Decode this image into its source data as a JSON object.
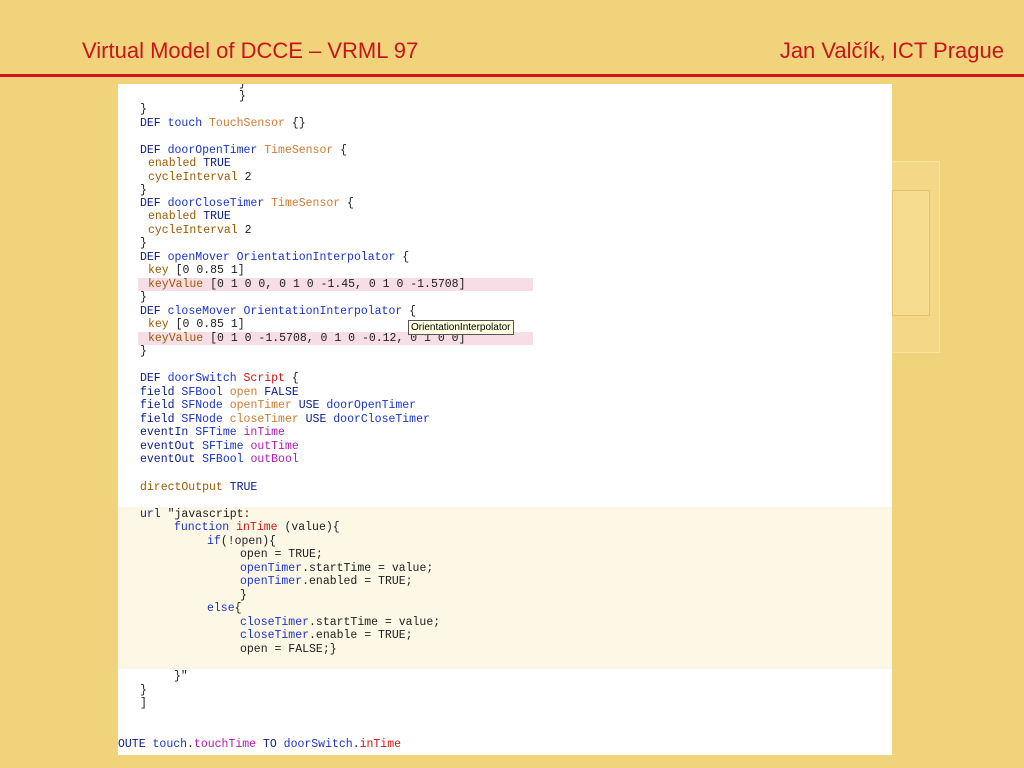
{
  "header": {
    "title": "Virtual Model of DCCE – VRML 97",
    "author": "Jan Valčík, ICT Prague"
  },
  "tooltip": "OrientationInterpolator",
  "code": {
    "l0": "}",
    "l1": "}",
    "l2": [
      "DEF ",
      "touch ",
      "TouchSensor",
      " {}"
    ],
    "l3": [
      "DEF ",
      "doorOpenTimer ",
      "TimeSensor",
      " {"
    ],
    "l4": [
      "enabled ",
      "TRUE"
    ],
    "l5": [
      "cycleInterval ",
      "2"
    ],
    "l6": "}",
    "l7": [
      "DEF ",
      "doorCloseTimer ",
      "TimeSensor",
      " {"
    ],
    "l8": [
      "enabled ",
      "TRUE"
    ],
    "l9": [
      "cycleInterval ",
      "2"
    ],
    "l10": "}",
    "l11": [
      "DEF ",
      "openMover ",
      "OrientationInterpolator",
      " {"
    ],
    "l12": [
      "key ",
      "[0 0.85 1]"
    ],
    "l13": [
      "keyValue ",
      "[0 1 0 0, 0 1 0 -1.45, 0 1 0 -1.5708]"
    ],
    "l14": "}",
    "l15": [
      "DEF ",
      "closeMover ",
      "OrientationInterpolator",
      " {"
    ],
    "l16": [
      "key ",
      "[0 0.85 1]"
    ],
    "l17": [
      "keyValue ",
      "[0 1 0 -1.5708, 0 1 0 -0.12, 0 1 0 0]"
    ],
    "l18": "}",
    "l19": [
      "DEF ",
      "doorSwitch ",
      "Script",
      " {"
    ],
    "l20": [
      "field ",
      "SFBool ",
      "open ",
      "FALSE"
    ],
    "l21": [
      "field ",
      "SFNode ",
      "openTimer ",
      "USE ",
      "doorOpenTimer"
    ],
    "l22": [
      "field ",
      "SFNode ",
      "closeTimer ",
      "USE ",
      "doorCloseTimer"
    ],
    "l23": [
      "eventIn ",
      "SFTime ",
      "inTime"
    ],
    "l24": [
      "eventOut ",
      "SFTime ",
      "outTime"
    ],
    "l25": [
      "eventOut ",
      "SFBool ",
      "outBool"
    ],
    "l26": [
      "directOutput ",
      "TRUE"
    ],
    "l27": [
      "url ",
      "\"javascript:"
    ],
    "l28": [
      "function ",
      "inTime",
      " (value){"
    ],
    "l29": [
      "if",
      "(!open){"
    ],
    "l30": "open = TRUE;",
    "l31": [
      "openTimer",
      ".startTime = value;"
    ],
    "l32": [
      "openTimer",
      ".enabled = TRUE;"
    ],
    "l33": "}",
    "l34": [
      "else",
      "{"
    ],
    "l35": [
      "closeTimer",
      ".startTime = value;"
    ],
    "l36": [
      "closeTimer",
      ".enable = TRUE;"
    ],
    "l37": "open = FALSE;}",
    "l38": "}\"",
    "l39": "}",
    "l40": "]",
    "l41": [
      "OUTE ",
      "touch",
      ".",
      "touchTime",
      " TO ",
      "doorSwitch",
      ".",
      "inTime"
    ]
  },
  "colors": {
    "background": "#f0d37b",
    "title": "#c8141e",
    "rule": "#d3151f",
    "keyword": "#0b1b8a",
    "identifier": "#1b34c8",
    "type": "#d07a32",
    "event": "#b21ab5"
  }
}
